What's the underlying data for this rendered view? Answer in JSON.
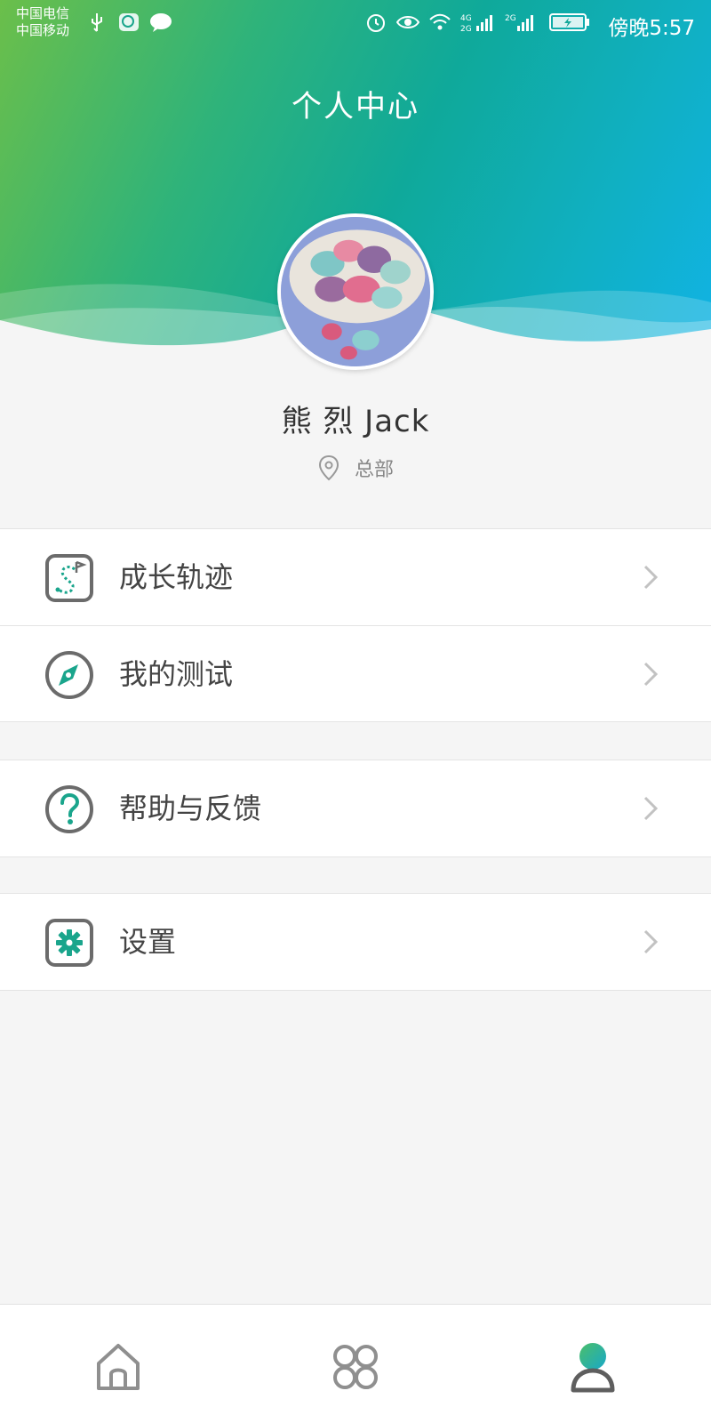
{
  "status_bar": {
    "carrier_1": "中国电信",
    "carrier_2": "中国移动",
    "time": "傍晚5:57",
    "network_1": "4G 2G",
    "network_2": "2G"
  },
  "header": {
    "title": "个人中心",
    "gradient_colors": [
      "#6bbf4a",
      "#0fa99a",
      "#11b3e6"
    ]
  },
  "profile": {
    "name": "熊 烈 Jack",
    "location": "总部",
    "avatar_icon": "avatar-photo"
  },
  "menu": {
    "group1": [
      {
        "label": "成长轨迹",
        "icon": "growth-path-icon"
      },
      {
        "label": "我的测试",
        "icon": "compass-icon"
      }
    ],
    "group2": [
      {
        "label": "帮助与反馈",
        "icon": "help-icon"
      }
    ],
    "group3": [
      {
        "label": "设置",
        "icon": "gear-icon"
      }
    ]
  },
  "tabbar": {
    "tabs": [
      {
        "icon": "home-icon"
      },
      {
        "icon": "apps-icon"
      },
      {
        "icon": "profile-icon",
        "active": true
      }
    ]
  },
  "colors": {
    "accent": "#1aa58c",
    "icon_gray": "#6b6b6b"
  }
}
